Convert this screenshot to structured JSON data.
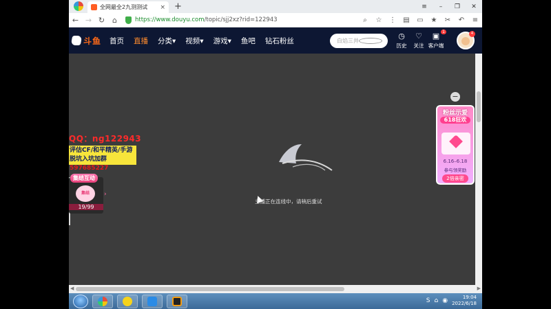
{
  "browser": {
    "tab_title": "全网最全2九测测试",
    "new_tab": "+",
    "tab_close": "×",
    "url_scheme_host": "https://www.douyu.com",
    "url_rest": "/topic/sjj2xz?rid=122943",
    "nav": {
      "back": "←",
      "forward": "→",
      "reload": "↻",
      "home": "⌂"
    },
    "window_controls": {
      "menu": "≡",
      "minimize": "–",
      "restore": "❐",
      "close": "✕"
    }
  },
  "site": {
    "logo_text": "斗鱼",
    "nav_items": [
      "首页",
      "直播",
      "分类▾",
      "视频▾",
      "游戏▾",
      "鱼吧",
      "钻石粉丝"
    ],
    "active_nav": "直播",
    "search_placeholder": "白焰三井",
    "header_icons": [
      {
        "glyph": "◷",
        "label": "历史"
      },
      {
        "glyph": "♡",
        "label": "关注"
      },
      {
        "glyph": "▣",
        "label": "客户端",
        "badge": "1"
      }
    ],
    "avatar_badge": "4"
  },
  "main": {
    "offline_message": "主播正在连线中，请稍后重试",
    "ad_qq": "QQ：ng122943",
    "ad_line1": "评估CF/和平精英/手游",
    "ad_line2_prefix": "脱坑入坑加群",
    "ad_line2_number": "597685227",
    "collect_title": "集结互动",
    "collect_pic": "集结",
    "collect_count": "19/99",
    "collect_arrow": "›",
    "close_promo": "−",
    "promo_title": "粉丝示爱",
    "promo_sub": "618狂欢",
    "promo_date": "6.16–6.18",
    "promo_desc": "参与领奖励",
    "promo_btn": "2倍亲密"
  },
  "taskbar": {
    "time": "19:04",
    "date": "2022/6/18",
    "tray_icons": [
      "S",
      "⌂",
      "◉"
    ]
  },
  "colors": {
    "header_bg": "#0d1733",
    "accent": "#ff6a18",
    "main_bg": "#3c3c3c",
    "ad_yellow": "#f7e53b"
  }
}
